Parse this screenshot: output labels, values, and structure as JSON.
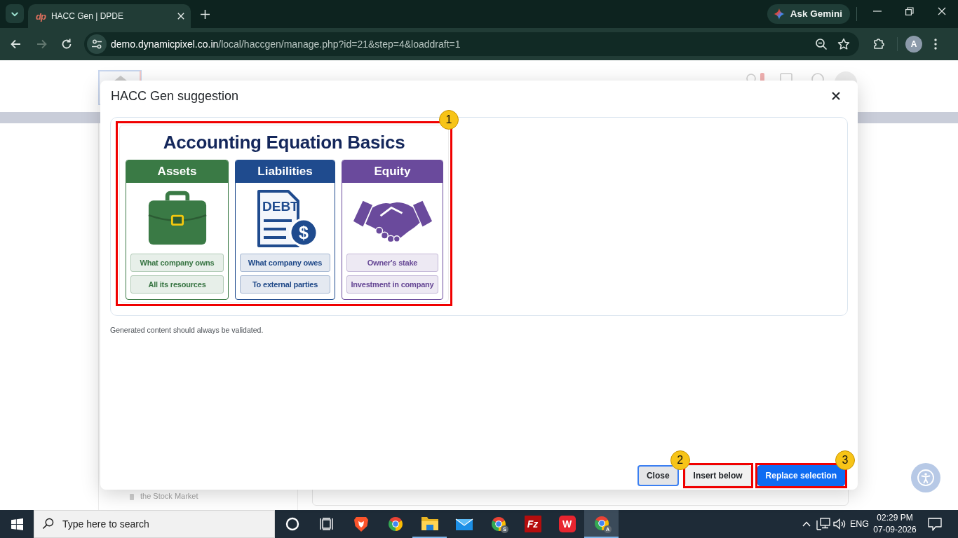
{
  "browser": {
    "tabs": [
      {
        "title": "HACC Gen | DPDE",
        "favicon_text": "dp",
        "selected": true
      }
    ],
    "gemini_label": "Ask Gemini",
    "nav": [
      {
        "kind": "back",
        "disabled": false
      },
      {
        "kind": "forward",
        "disabled": true
      },
      {
        "kind": "reload",
        "disabled": false
      }
    ],
    "address": {
      "host": "demo.dynamicpixel.co.in",
      "path": "/local/haccgen/manage.php?id=21&step=4&loaddraft=1"
    },
    "profile_initial": "A"
  },
  "background_page": {
    "sidebar_item": "the Stock Market"
  },
  "modal": {
    "title": "HACC Gen suggestion",
    "image": {
      "title": "Accounting Equation Basics",
      "callout": {
        "number": "1",
        "kind": "trailing"
      },
      "columns": [
        {
          "heading": "Assets",
          "kind": "briefcase",
          "color": "#3a7a45",
          "points": [
            "What company owns",
            "All its resources"
          ]
        },
        {
          "heading": "Liabilities",
          "kind": "document",
          "color": "#1f4b8e",
          "icon_text": "DEBT",
          "coin_text": "$",
          "points": [
            "What company owes",
            "To external parties"
          ]
        },
        {
          "heading": "Equity",
          "kind": "handshake",
          "color": "#6a4a9c",
          "points": [
            "Owner's stake",
            "Investment in company"
          ]
        }
      ]
    },
    "note": "Generated content should always be validated.",
    "buttons": [
      {
        "label": "Close",
        "kind": "secondary",
        "focused": true
      },
      {
        "label": "Insert below",
        "kind": "light",
        "focused": false,
        "callout": {
          "number": "2",
          "kind": "leading"
        }
      },
      {
        "label": "Replace selection",
        "kind": "primary",
        "focused": false,
        "callout": {
          "number": "3",
          "kind": "trailing"
        }
      }
    ]
  },
  "taskbar": {
    "search_placeholder": "Type here to search",
    "apps": [
      {
        "kind": "cortana",
        "running": false,
        "selected": false
      },
      {
        "kind": "task-view",
        "running": false,
        "selected": false
      },
      {
        "kind": "brave",
        "running": false,
        "selected": false
      },
      {
        "kind": "chrome",
        "running": false,
        "selected": false
      },
      {
        "kind": "explorer",
        "running": true,
        "selected": false
      },
      {
        "kind": "mail",
        "running": false,
        "selected": false
      },
      {
        "kind": "chrome",
        "badge": "S",
        "running": false,
        "selected": false
      },
      {
        "kind": "filezilla",
        "logo_text": "Fz",
        "running": false,
        "selected": false
      },
      {
        "kind": "wps",
        "logo_text": "W",
        "running": false,
        "selected": false
      },
      {
        "kind": "chrome",
        "badge": "A",
        "running": true,
        "selected": true
      }
    ],
    "language": "ENG",
    "time": "02:29 PM",
    "date": "07-09-2026"
  }
}
